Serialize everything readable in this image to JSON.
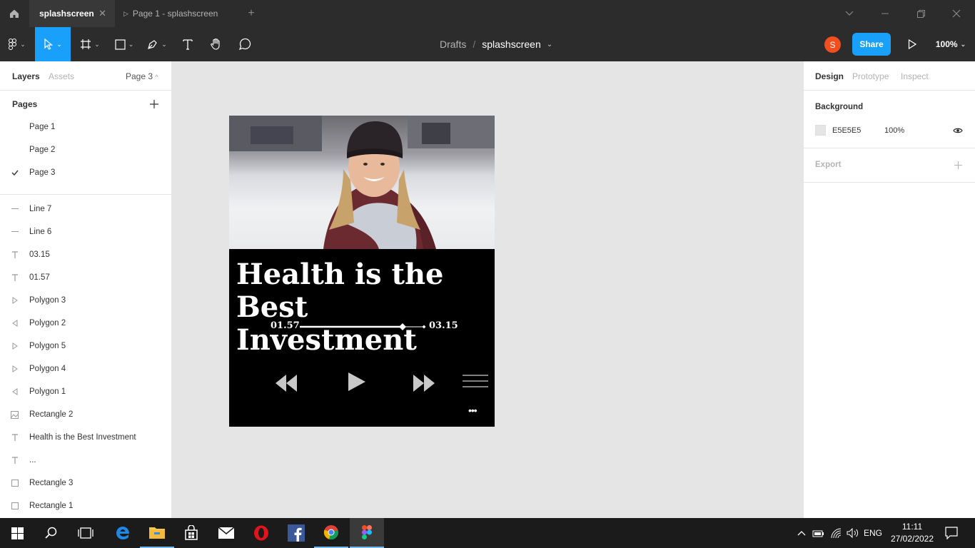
{
  "titlebar": {
    "tabs": [
      {
        "label": "splashscreen",
        "active": true
      },
      {
        "label": "Page 1 - splashscreen",
        "active": false
      }
    ]
  },
  "toolbar": {
    "breadcrumb_root": "Drafts",
    "breadcrumb_sep": "/",
    "file_name": "splashscreen",
    "avatar_initial": "S",
    "share_label": "Share",
    "zoom": "100%",
    "accent_color": "#18a0fb",
    "avatar_color": "#f24e1e"
  },
  "left_panel": {
    "tabs": {
      "layers": "Layers",
      "assets": "Assets",
      "page_selector": "Page 3"
    },
    "pages_title": "Pages",
    "pages": [
      {
        "label": "Page 1",
        "checked": false
      },
      {
        "label": "Page 2",
        "checked": false
      },
      {
        "label": "Page 3",
        "checked": true
      }
    ],
    "layers": [
      {
        "label": "Line 7",
        "icon": "line-icon"
      },
      {
        "label": "Line 6",
        "icon": "line-icon"
      },
      {
        "label": "03.15",
        "icon": "text-icon"
      },
      {
        "label": "01.57",
        "icon": "text-icon"
      },
      {
        "label": "Polygon 3",
        "icon": "polygon-right-icon"
      },
      {
        "label": "Polygon 2",
        "icon": "polygon-left-icon"
      },
      {
        "label": "Polygon 5",
        "icon": "polygon-right-icon"
      },
      {
        "label": "Polygon 4",
        "icon": "polygon-right-icon"
      },
      {
        "label": "Polygon 1",
        "icon": "polygon-left-icon"
      },
      {
        "label": "Rectangle 2",
        "icon": "image-icon"
      },
      {
        "label": "Health is the Best Investment",
        "icon": "text-icon"
      },
      {
        "label": "...",
        "icon": "text-icon"
      },
      {
        "label": "Rectangle 3",
        "icon": "rectangle-icon"
      },
      {
        "label": "Rectangle 1",
        "icon": "rectangle-icon"
      }
    ]
  },
  "right_panel": {
    "tabs": {
      "design": "Design",
      "prototype": "Prototype",
      "inspect": "Inspect"
    },
    "background_title": "Background",
    "background_hex": "E5E5E5",
    "background_opacity": "100%",
    "export_title": "Export"
  },
  "frame": {
    "headline_line1": "Health is the Best",
    "headline_line2": "Investment",
    "time_elapsed": "01.57",
    "time_total": "03.15",
    "progress": 0.82,
    "more_label": "•••"
  },
  "help_label": "?",
  "taskbar": {
    "language": "ENG",
    "time": "11:11",
    "date": "27/02/2022"
  }
}
